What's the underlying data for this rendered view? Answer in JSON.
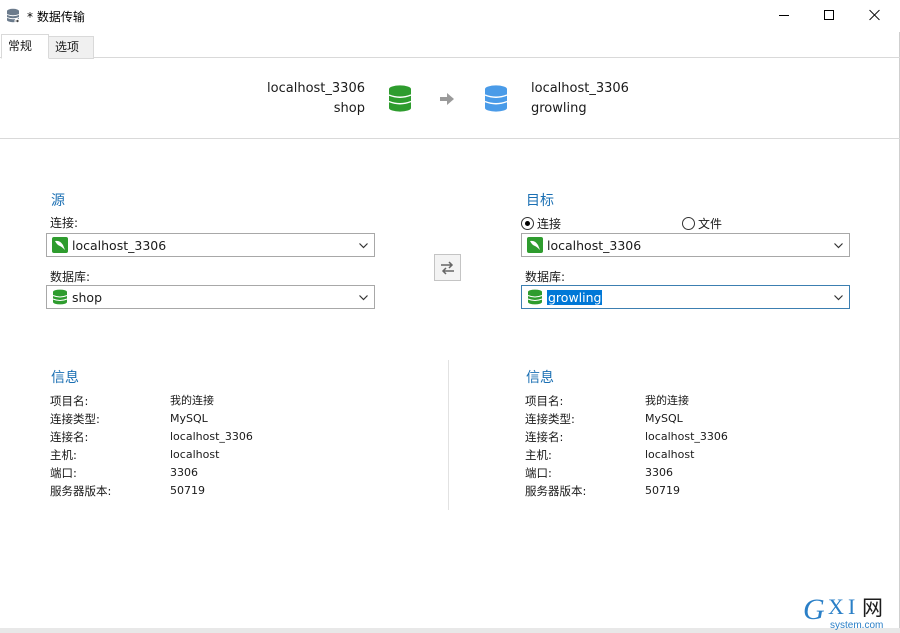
{
  "window": {
    "title": "* 数据传输",
    "icon": "database-transfer-icon"
  },
  "tabs": [
    {
      "label": "常规",
      "active": true
    },
    {
      "label": "选项",
      "active": false
    }
  ],
  "summary": {
    "source_connection": "localhost_3306",
    "source_database": "shop",
    "target_connection": "localhost_3306",
    "target_database": "growling",
    "source_icon_color": "#2e9c2e",
    "target_icon_color": "#4a9be8"
  },
  "source": {
    "heading": "源",
    "connection_label": "连接:",
    "connection_value": "localhost_3306",
    "database_label": "数据库:",
    "database_value": "shop"
  },
  "target": {
    "heading": "目标",
    "radio_connection": "连接",
    "radio_file": "文件",
    "selected_mode": "连接",
    "connection_value": "localhost_3306",
    "database_label": "数据库:",
    "database_value": "growling"
  },
  "info_left": {
    "heading": "信息",
    "rows": [
      {
        "key": "项目名:",
        "value": "我的连接"
      },
      {
        "key": "连接类型:",
        "value": "MySQL"
      },
      {
        "key": "连接名:",
        "value": "localhost_3306"
      },
      {
        "key": "主机:",
        "value": "localhost"
      },
      {
        "key": "端口:",
        "value": "3306"
      },
      {
        "key": "服务器版本:",
        "value": "50719"
      }
    ]
  },
  "info_right": {
    "heading": "信息",
    "rows": [
      {
        "key": "项目名:",
        "value": "我的连接"
      },
      {
        "key": "连接类型:",
        "value": "MySQL"
      },
      {
        "key": "连接名:",
        "value": "localhost_3306"
      },
      {
        "key": "主机:",
        "value": "localhost"
      },
      {
        "key": "端口:",
        "value": "3306"
      },
      {
        "key": "服务器版本:",
        "value": "50719"
      }
    ]
  },
  "watermark": {
    "text": "GXI网",
    "subtext": "system.com"
  },
  "colors": {
    "accent_heading": "#1a6fb3",
    "selection": "#0078d7"
  }
}
